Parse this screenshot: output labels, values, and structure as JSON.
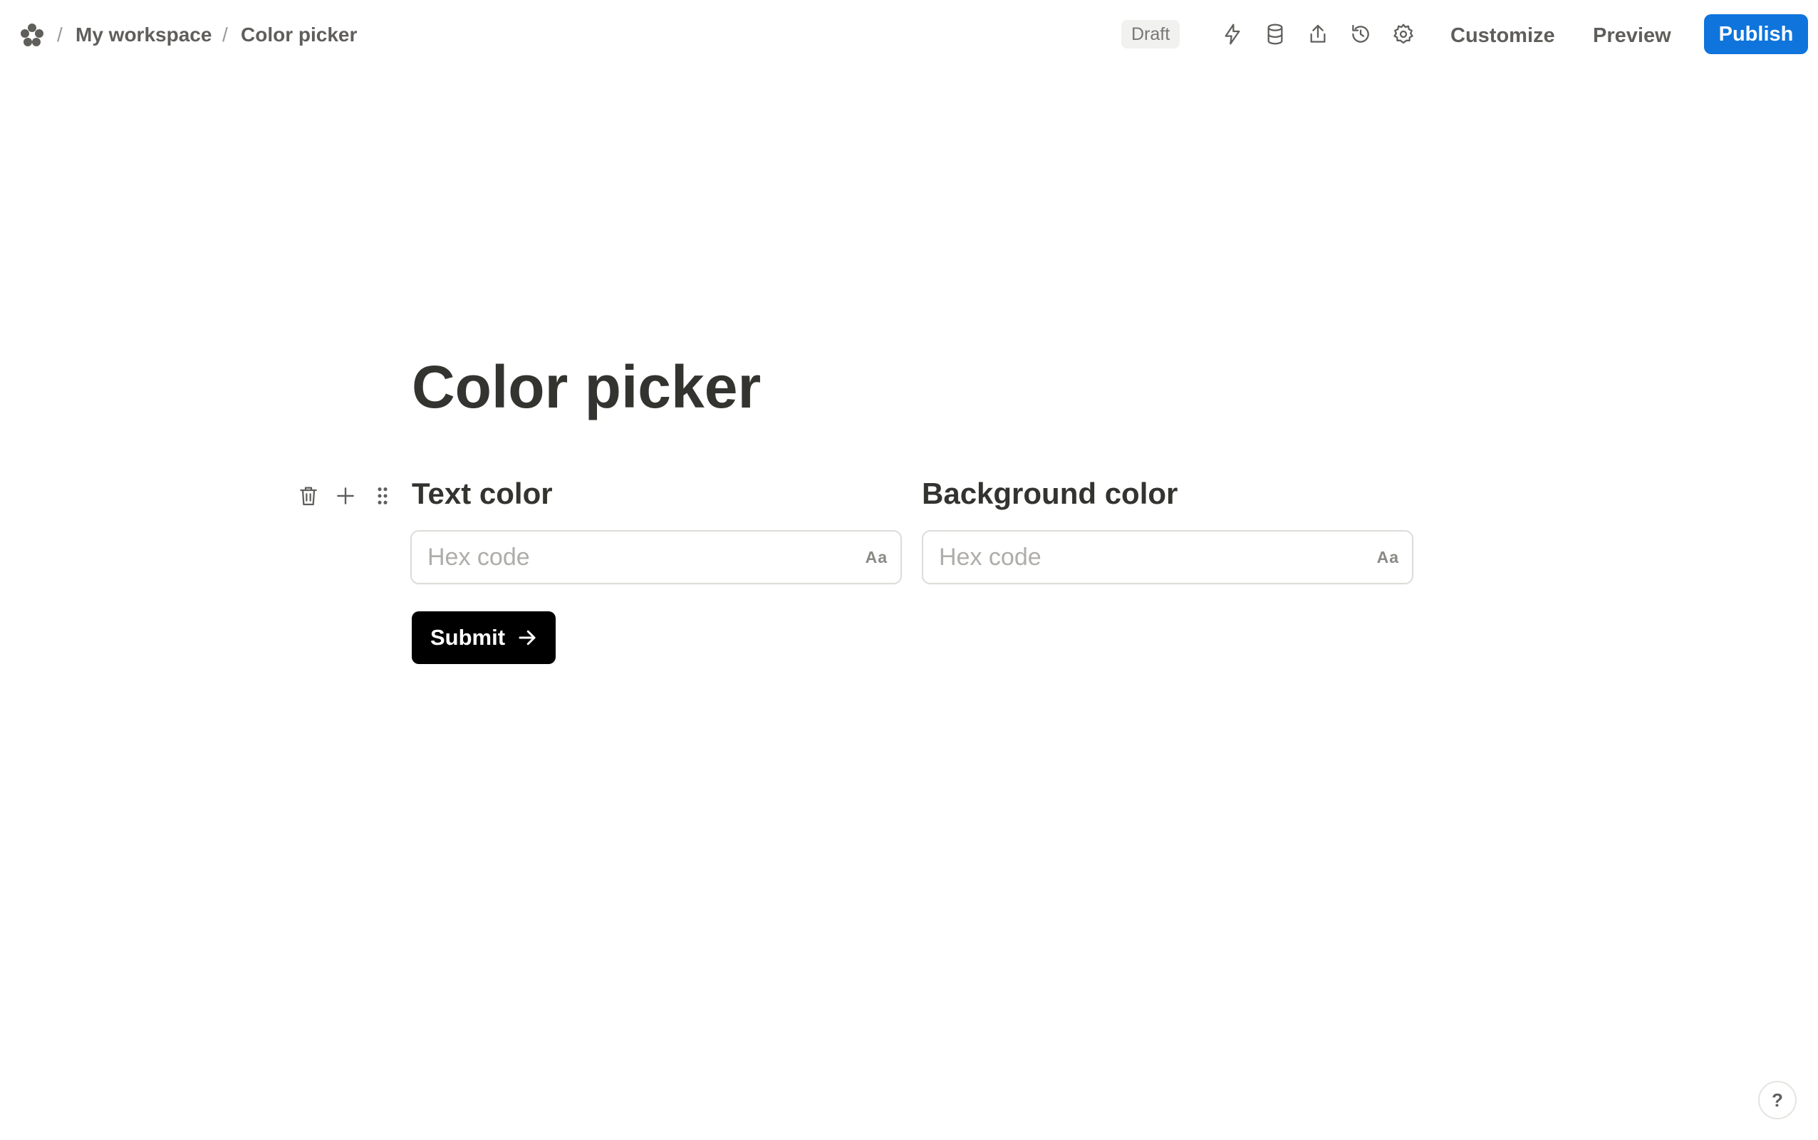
{
  "header": {
    "breadcrumb": [
      {
        "label": "My workspace"
      },
      {
        "label": "Color picker"
      }
    ],
    "separator": "/",
    "status_badge": "Draft",
    "tools": [
      "lightning-icon",
      "database-icon",
      "share-icon",
      "history-icon",
      "settings-icon"
    ],
    "customize_label": "Customize",
    "preview_label": "Preview",
    "publish_label": "Publish"
  },
  "form": {
    "title": "Color picker",
    "fields": [
      {
        "label": "Text color",
        "placeholder": "Hex code",
        "value": "",
        "type_indicator": "Aa"
      },
      {
        "label": "Background color",
        "placeholder": "Hex code",
        "value": "",
        "type_indicator": "Aa"
      }
    ],
    "submit_label": "Submit"
  },
  "help": {
    "label": "?"
  },
  "colors": {
    "accent": "#0f74dc",
    "submit_bg": "#000000",
    "text": "#37352f"
  }
}
